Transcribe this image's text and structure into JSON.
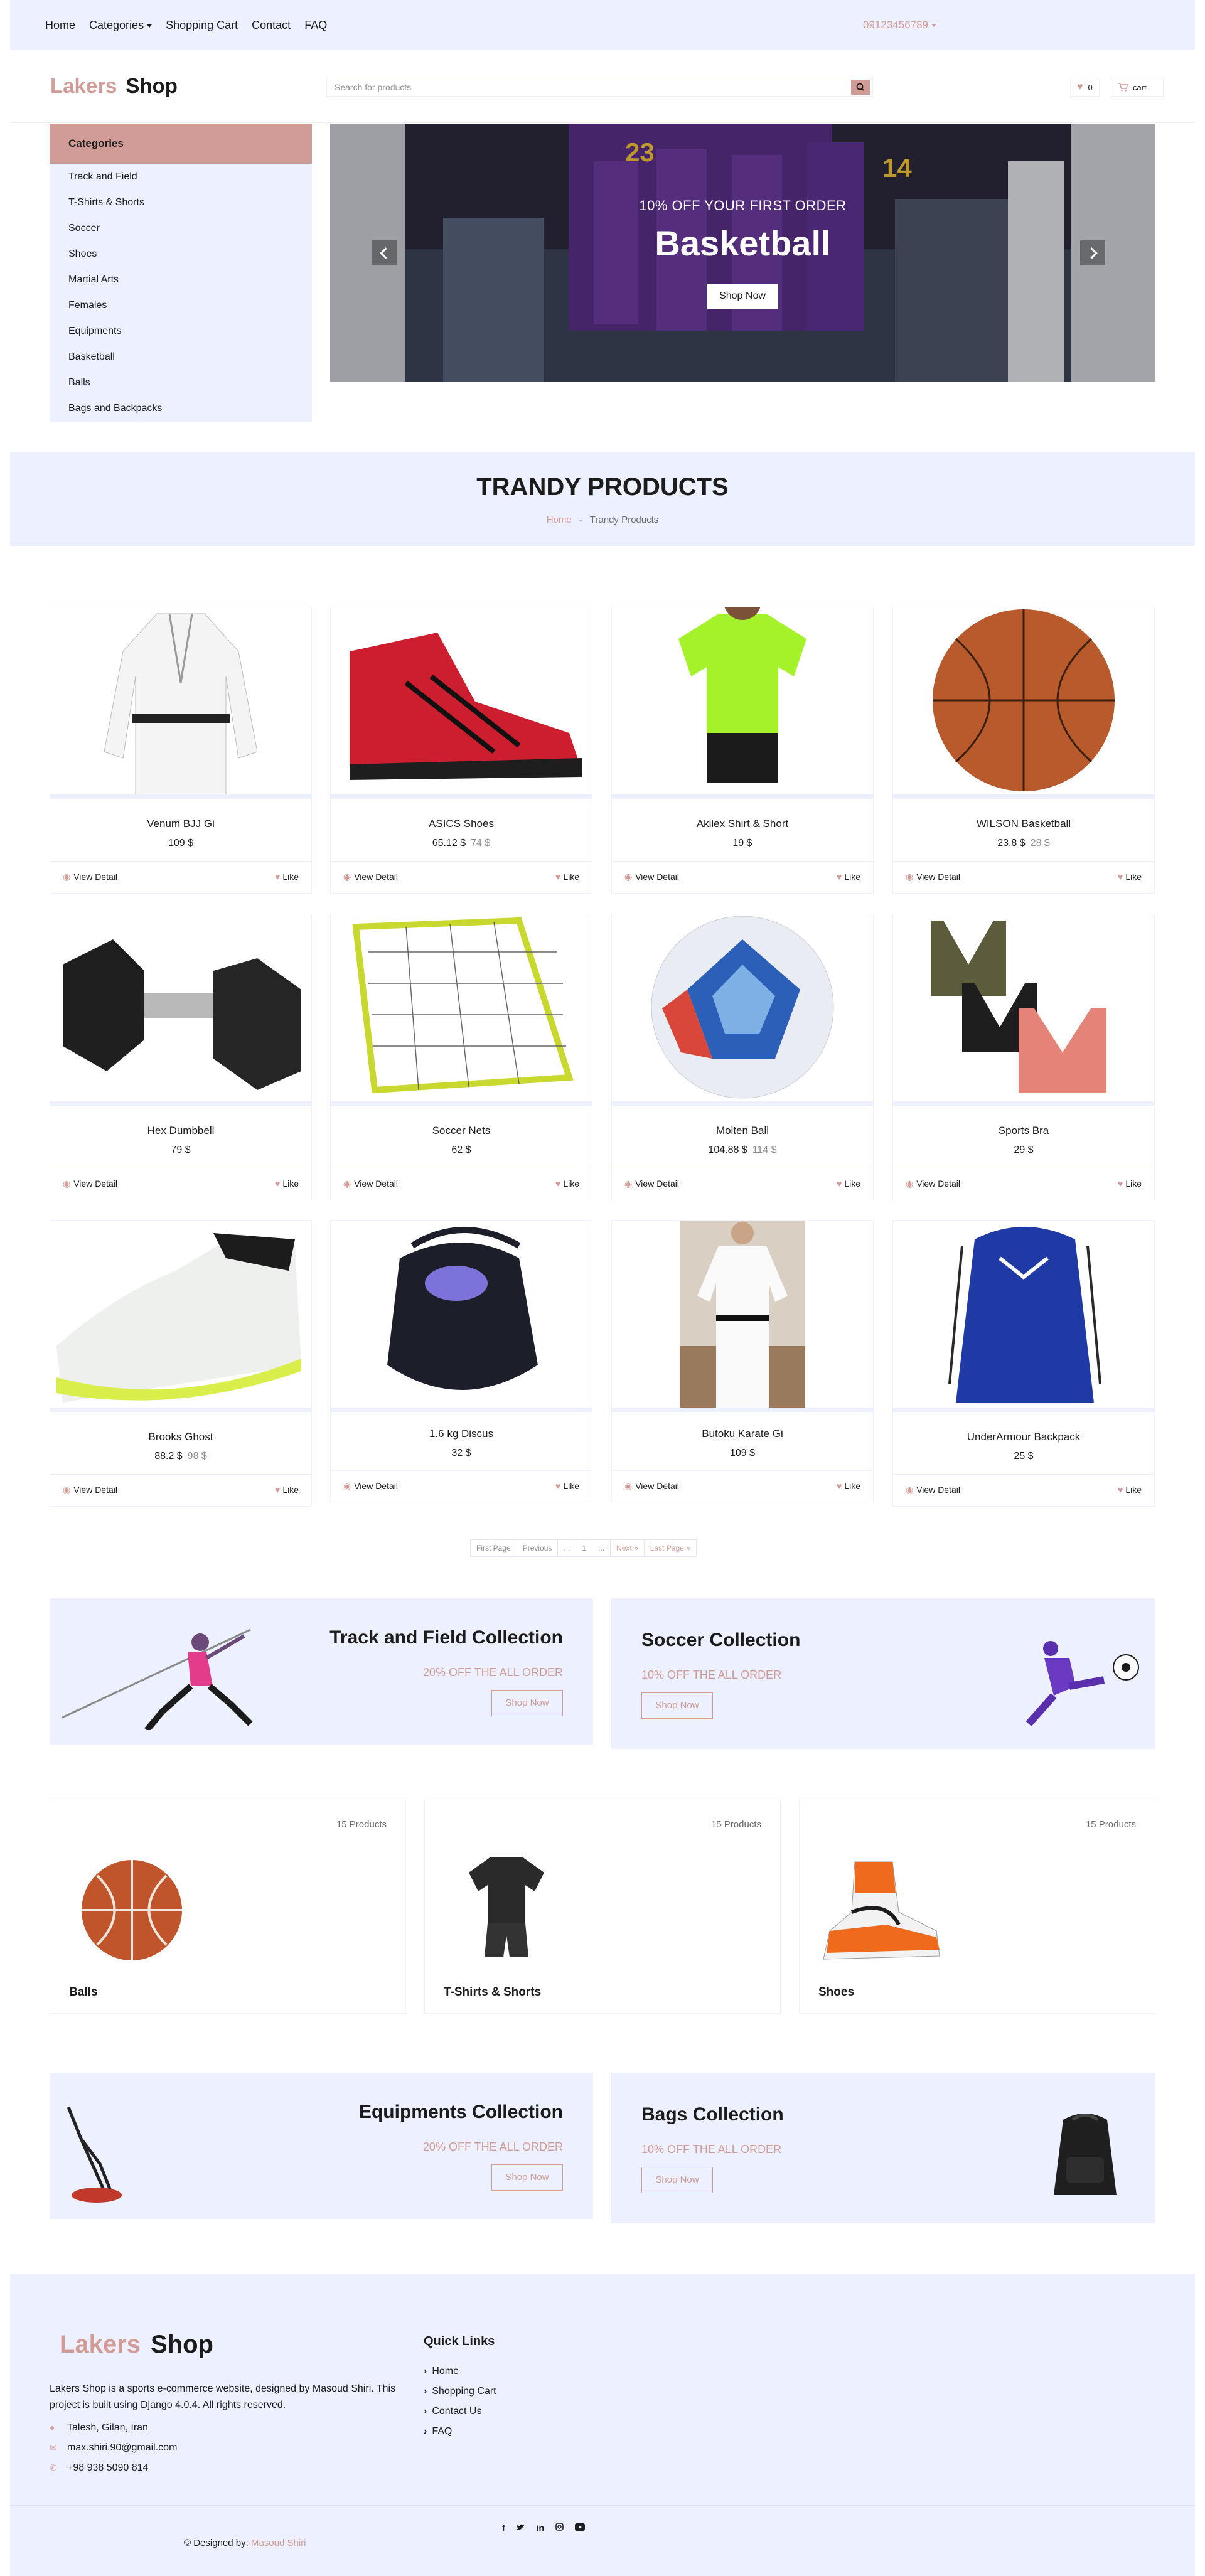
{
  "topbar": {
    "nav": [
      "Home",
      "Categories",
      "Shopping Cart",
      "Contact",
      "FAQ"
    ],
    "phone": "09123456789"
  },
  "header": {
    "logo_a": "Lakers",
    "logo_b": "Shop",
    "search_placeholder": "Search for products",
    "wishlist_count": "0",
    "cart_label": "cart"
  },
  "sidebar": {
    "title": "Categories",
    "items": [
      "Track and Field",
      "T-Shirts & Shorts",
      "Soccer",
      "Shoes",
      "Martial Arts",
      "Females",
      "Equipments",
      "Basketball",
      "Balls",
      "Bags and Backpacks"
    ]
  },
  "banner": {
    "small": "10% OFF YOUR FIRST ORDER",
    "big": "Basketball",
    "button": "Shop Now"
  },
  "trandy": {
    "title": "TRANDY PRODUCTS",
    "crumb_home": "Home",
    "crumb_sep": "-",
    "crumb_current": "Trandy Products"
  },
  "card_actions": {
    "view": "View Detail",
    "like": "Like"
  },
  "products": [
    {
      "name": "Venum BJJ Gi",
      "price": "109 $",
      "old": ""
    },
    {
      "name": "ASICS Shoes",
      "price": "65.12 $",
      "old": "74 $"
    },
    {
      "name": "Akilex Shirt & Short",
      "price": "19 $",
      "old": ""
    },
    {
      "name": "WILSON Basketball",
      "price": "23.8 $",
      "old": "28 $"
    },
    {
      "name": "Hex Dumbbell",
      "price": "79 $",
      "old": ""
    },
    {
      "name": "Soccer Nets",
      "price": "62 $",
      "old": ""
    },
    {
      "name": "Molten Ball",
      "price": "104.88 $",
      "old": "114 $"
    },
    {
      "name": "Sports Bra",
      "price": "29 $",
      "old": ""
    },
    {
      "name": "Brooks Ghost",
      "price": "88.2 $",
      "old": "98 $"
    },
    {
      "name": "1.6 kg Discus",
      "price": "32 $",
      "old": ""
    },
    {
      "name": "Butoku Karate Gi",
      "price": "109 $",
      "old": ""
    },
    {
      "name": "UnderArmour Backpack",
      "price": "25 $",
      "old": ""
    }
  ],
  "pagination": [
    "First Page",
    "Previous",
    "...",
    "1",
    "...",
    "Next »",
    "Last Page »"
  ],
  "offers": [
    {
      "title": "Track and Field Collection",
      "disc": "20% OFF THE ALL ORDER",
      "btn": "Shop Now"
    },
    {
      "title": "Soccer Collection",
      "disc": "10% OFF THE ALL ORDER",
      "btn": "Shop Now"
    },
    {
      "title": "Equipments Collection",
      "disc": "20% OFF THE ALL ORDER",
      "btn": "Shop Now"
    },
    {
      "title": "Bags Collection",
      "disc": "10% OFF THE ALL ORDER",
      "btn": "Shop Now"
    }
  ],
  "categories": [
    {
      "count": "15 Products",
      "name": "Balls"
    },
    {
      "count": "15 Products",
      "name": "T-Shirts & Shorts"
    },
    {
      "count": "15 Products",
      "name": "Shoes"
    }
  ],
  "footer": {
    "logo_a": "Lakers",
    "logo_b": "Shop",
    "desc": "Lakers Shop is a sports e-commerce website, designed by Masoud Shiri. This project is built using Django 4.0.4. All rights reserved.",
    "address": "Talesh, Gilan, Iran",
    "email": "max.shiri.90@gmail.com",
    "phone": "+98 938 5090 814",
    "quick_title": "Quick Links",
    "links": [
      "Home",
      "Shopping Cart",
      "Contact Us",
      "FAQ"
    ],
    "copy_prefix": "© Designed by:",
    "copy_name": "Masoud Shiri"
  },
  "colors": {
    "accent": "#d19c97",
    "light": "#edf1ff",
    "dark": "#1c1c1c"
  }
}
